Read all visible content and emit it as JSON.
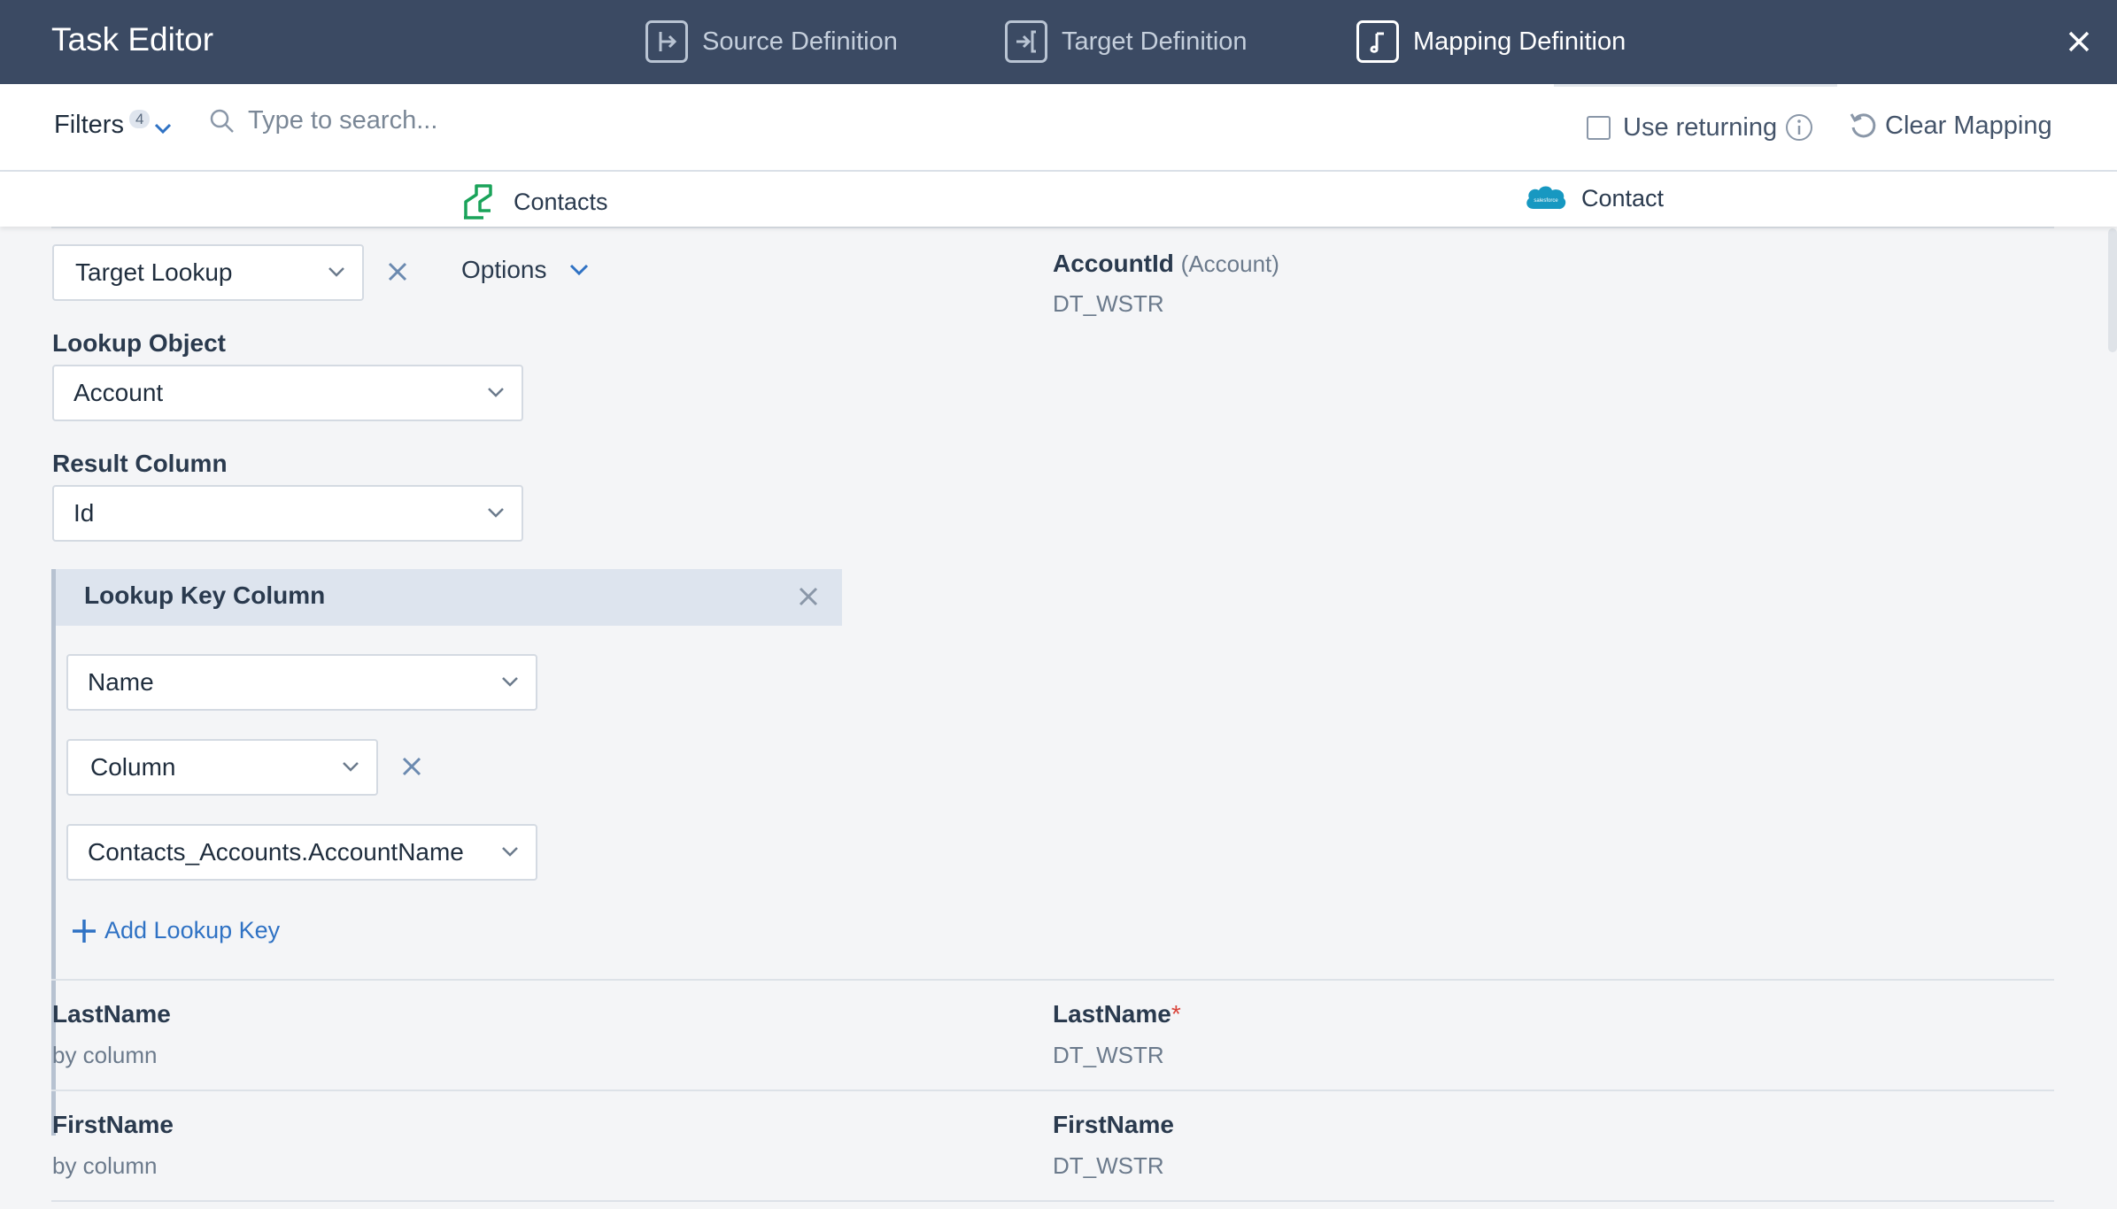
{
  "header": {
    "title": "Task Editor",
    "tabs": [
      {
        "label": "Source Definition",
        "icon": "source-definition-icon"
      },
      {
        "label": "Target Definition",
        "icon": "target-definition-icon"
      },
      {
        "label": "Mapping Definition",
        "icon": "mapping-definition-icon"
      }
    ],
    "active_tab": "Mapping Definition"
  },
  "toolbar": {
    "filters_label": "Filters",
    "filters_count": "4",
    "search_placeholder": "Type to search...",
    "use_returning_label": "Use returning",
    "use_returning_checked": false,
    "clear_mapping_label": "Clear Mapping"
  },
  "objects": {
    "source": "Contacts",
    "target": "Contact",
    "target_logo_text": "salesforce"
  },
  "mapping": {
    "mapping_type": "Target Lookup",
    "options_label": "Options",
    "target_field": {
      "name": "AccountId",
      "ref": "(Account)",
      "type": "DT_WSTR"
    },
    "lookup_object_label": "Lookup Object",
    "lookup_object_value": "Account",
    "result_column_label": "Result Column",
    "result_column_value": "Id",
    "lookup_key": {
      "title": "Lookup Key Column",
      "column_value": "Name",
      "source_type": "Column",
      "source_value": "Contacts_Accounts.AccountName"
    },
    "add_lookup_key_label": "Add Lookup Key"
  },
  "rows": [
    {
      "source_name": "LastName",
      "source_meta": "by column",
      "target_name": "LastName",
      "required": "*",
      "target_type": "DT_WSTR"
    },
    {
      "source_name": "FirstName",
      "source_meta": "by column",
      "target_name": "FirstName",
      "required": "",
      "target_type": "DT_WSTR"
    }
  ],
  "colors": {
    "header_bg": "#3b4a63",
    "accent": "#2f72c4",
    "source_icon": "#1aa35a",
    "salesforce": "#1798c1",
    "required": "#d9443a"
  }
}
